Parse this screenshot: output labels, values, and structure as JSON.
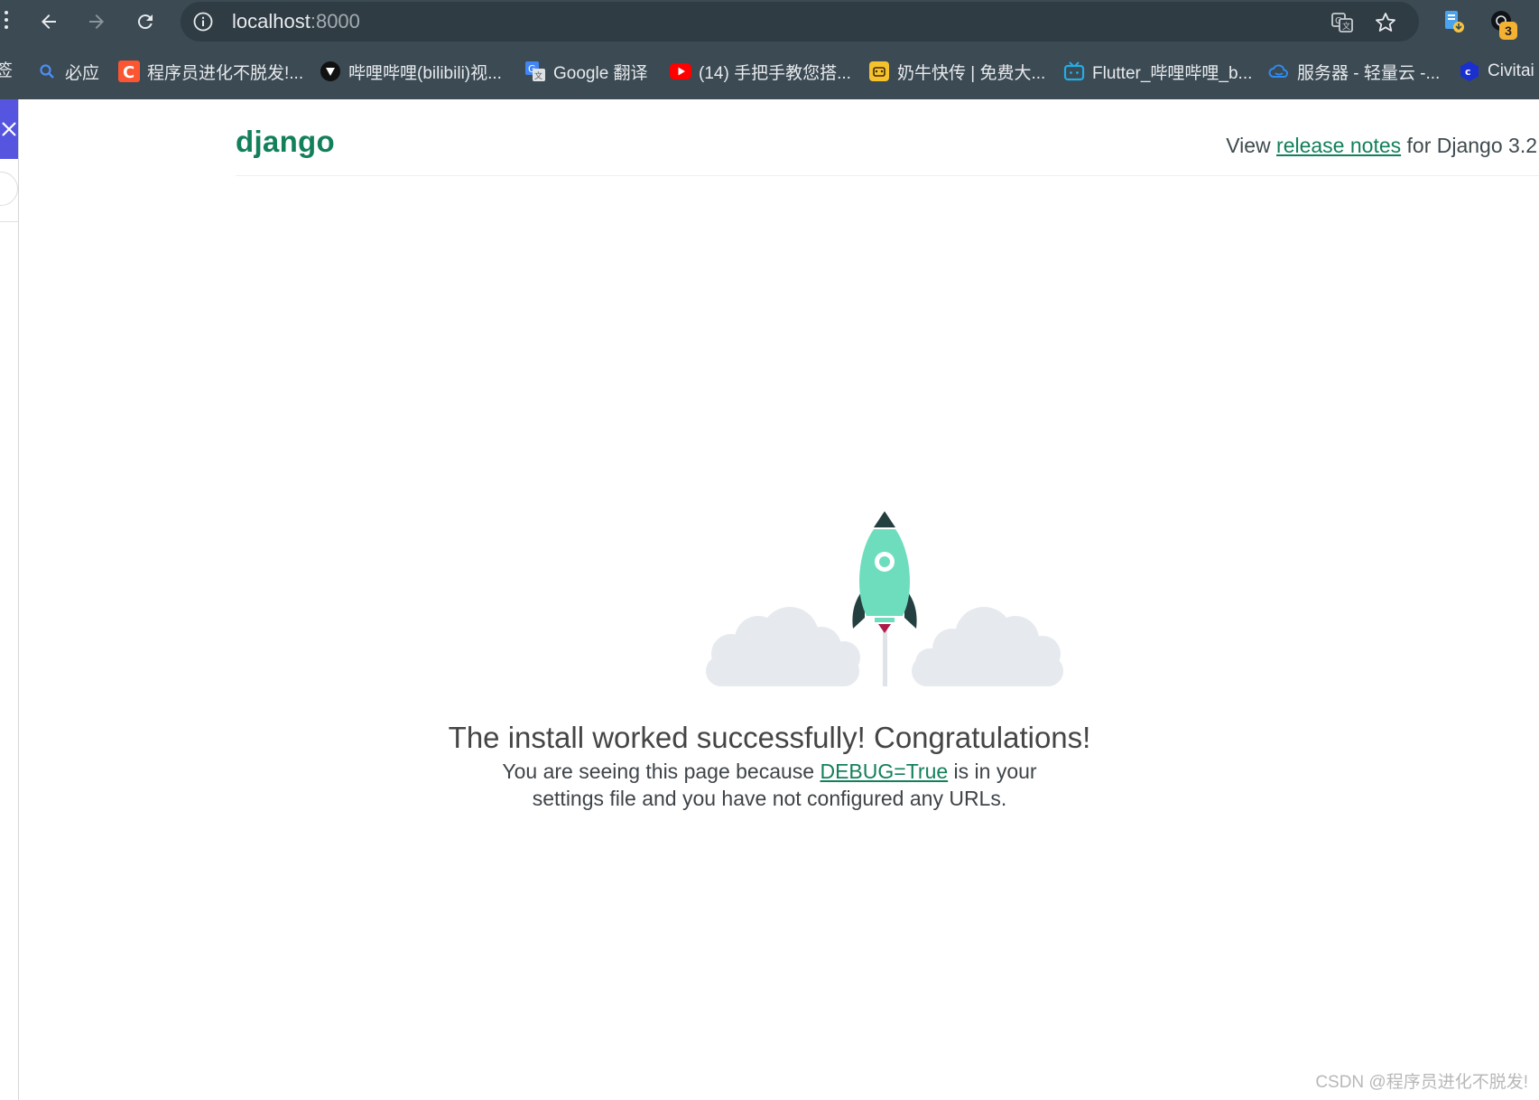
{
  "browser": {
    "url_host": "localhost",
    "url_port": ":8000",
    "extension_badge": "3"
  },
  "bookmarks": {
    "cut_label": "签",
    "items": [
      {
        "label": "必应",
        "icon": "bing-search-icon"
      },
      {
        "label": "程序员进化不脱发!...",
        "icon": "csdn-icon"
      },
      {
        "label": "哔哩哔哩(bilibili)视...",
        "icon": "bilibili-icon"
      },
      {
        "label": "Google 翻译",
        "icon": "google-translate-icon"
      },
      {
        "label": "(14) 手把手教您搭...",
        "icon": "youtube-icon"
      },
      {
        "label": "奶牛快传 | 免费大...",
        "icon": "cow-transfer-icon"
      },
      {
        "label": "Flutter_哔哩哔哩_b...",
        "icon": "bilibili-tv-icon"
      },
      {
        "label": "服务器 - 轻量云 -...",
        "icon": "cloud-icon"
      },
      {
        "label": "Civitai",
        "icon": "civitai-icon"
      }
    ]
  },
  "page": {
    "logo": "django",
    "release_prefix": "View ",
    "release_link": "release notes",
    "release_suffix": " for Django 3.2",
    "headline": "The install worked successfully! Congratulations!",
    "desc_prefix": "You are seeing this page because ",
    "desc_link": "DEBUG=True",
    "desc_line1_suffix": " is in your",
    "desc_line2": "settings file and you have not configured any URLs."
  },
  "watermark": "CSDN @程序员进化不脱发!",
  "colors": {
    "chrome_bg": "#3b4a53",
    "omnibox_bg": "#2f3c44",
    "django_green": "#138059",
    "rocket_body": "#6dddbe",
    "rocket_dark": "#243f3f",
    "cloud": "#e6e9ee",
    "side_panel_accent": "#5555e0"
  }
}
